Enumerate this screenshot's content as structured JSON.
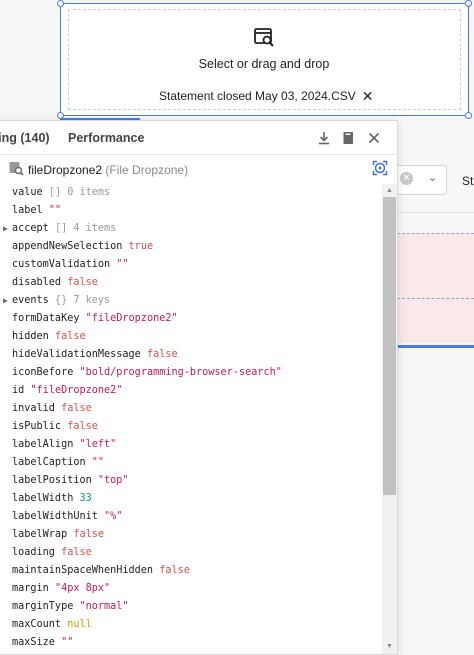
{
  "dropzone": {
    "prompt": "Select or drag and drop",
    "file_name": "Statement closed May 03, 2024.CSV",
    "remove_glyph": "✕",
    "icon": "file-search-icon"
  },
  "background": {
    "select_clear_glyph": "✕",
    "select_chevron_glyph": "⌄",
    "partial_label": "St"
  },
  "inspector": {
    "tabs": [
      {
        "label": "ting (140)"
      },
      {
        "label": "Performance"
      }
    ],
    "header_icons": [
      "download-icon",
      "book-icon",
      "close-icon"
    ],
    "component_name": "fileDropzone2",
    "component_type": "(File Dropzone)",
    "properties": [
      {
        "key": "value",
        "value": "[]",
        "meta": "0 items",
        "kind": "meta",
        "expandable": false
      },
      {
        "key": "label",
        "value": "\"\"",
        "kind": "string",
        "expandable": false
      },
      {
        "key": "accept",
        "value": "[]",
        "meta": "4 items",
        "kind": "meta",
        "expandable": true
      },
      {
        "key": "appendNewSelection",
        "value": "true",
        "kind": "bool",
        "expandable": false
      },
      {
        "key": "customValidation",
        "value": "\"\"",
        "kind": "string",
        "expandable": false
      },
      {
        "key": "disabled",
        "value": "false",
        "kind": "bool",
        "expandable": false
      },
      {
        "key": "events",
        "value": "{}",
        "meta": "7 keys",
        "kind": "meta",
        "expandable": true
      },
      {
        "key": "formDataKey",
        "value": "\"fileDropzone2\"",
        "kind": "string",
        "expandable": false
      },
      {
        "key": "hidden",
        "value": "false",
        "kind": "bool",
        "expandable": false
      },
      {
        "key": "hideValidationMessage",
        "value": "false",
        "kind": "bool",
        "expandable": false
      },
      {
        "key": "iconBefore",
        "value": "\"bold/programming-browser-search\"",
        "kind": "string",
        "expandable": false
      },
      {
        "key": "id",
        "value": "\"fileDropzone2\"",
        "kind": "string",
        "expandable": false
      },
      {
        "key": "invalid",
        "value": "false",
        "kind": "bool",
        "expandable": false
      },
      {
        "key": "isPublic",
        "value": "false",
        "kind": "bool",
        "expandable": false
      },
      {
        "key": "labelAlign",
        "value": "\"left\"",
        "kind": "string",
        "expandable": false
      },
      {
        "key": "labelCaption",
        "value": "\"\"",
        "kind": "string",
        "expandable": false
      },
      {
        "key": "labelPosition",
        "value": "\"top\"",
        "kind": "string",
        "expandable": false
      },
      {
        "key": "labelWidth",
        "value": "33",
        "kind": "number",
        "expandable": false
      },
      {
        "key": "labelWidthUnit",
        "value": "\"%\"",
        "kind": "string",
        "expandable": false
      },
      {
        "key": "labelWrap",
        "value": "false",
        "kind": "bool",
        "expandable": false
      },
      {
        "key": "loading",
        "value": "false",
        "kind": "bool",
        "expandable": false
      },
      {
        "key": "maintainSpaceWhenHidden",
        "value": "false",
        "kind": "bool",
        "expandable": false
      },
      {
        "key": "margin",
        "value": "\"4px 8px\"",
        "kind": "string",
        "expandable": false
      },
      {
        "key": "marginType",
        "value": "\"normal\"",
        "kind": "string",
        "expandable": false
      },
      {
        "key": "maxCount",
        "value": "null",
        "kind": "null",
        "expandable": false
      },
      {
        "key": "maxSize",
        "value": "\"\"",
        "kind": "string",
        "expandable": false
      }
    ]
  },
  "colors": {
    "accent": "#4a7ae8",
    "string": "#c41a5a",
    "boolean": "#d4504c",
    "number": "#1a9a6a",
    "null": "#cc9a00",
    "meta": "#9a9a9a"
  }
}
